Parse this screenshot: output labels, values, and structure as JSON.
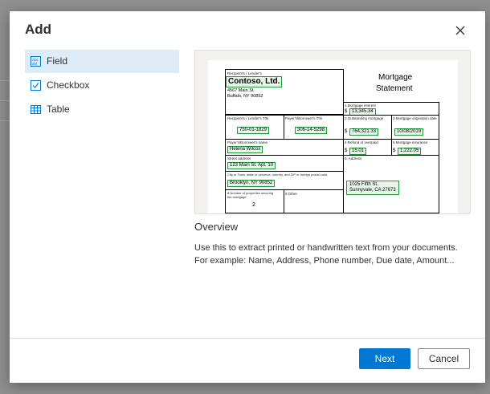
{
  "dialog": {
    "title": "Add",
    "close_icon": "close-icon"
  },
  "sidebar": {
    "items": [
      {
        "label": "Field",
        "icon": "field-icon",
        "active": true
      },
      {
        "label": "Checkbox",
        "icon": "checkbox-icon",
        "active": false
      },
      {
        "label": "Table",
        "icon": "table-icon",
        "active": false
      }
    ]
  },
  "preview": {
    "form_title_line1": "Mortgage",
    "form_title_line2": "Statement",
    "lender_label": "Recipient's / Lender's",
    "lender_name": "Contoso, Ltd.",
    "lender_address1": "4567 Main St.",
    "lender_address2": "Buffalo, NY 90852",
    "interest_label": "1.Mortgage interest",
    "interest_value": "13,345.34",
    "lender_tin_label": "Recipient's / Lender's TIN",
    "lender_tin_value": "750-01-1829",
    "payer_tin_label": "Payer's/Borrower's TIN",
    "payer_tin_value": "306-14-5298",
    "outstanding_label": "2.Outstanding mortgage",
    "outstanding_value": "764,321.33",
    "origination_label": "3.Mortgage origination date",
    "origination_value": "10/08/2019",
    "payer_name_label": "Payer's/Borrower's name",
    "payer_name_value": "Helena Wilcox",
    "refund_label": "4.Refund of overpaid",
    "refund_value": "15.01",
    "insurance_label": "5.Mortgage insurance",
    "insurance_value": "1,222.05",
    "street_label": "Street address",
    "street_value": "123 Main St. Apt. 10",
    "address_label": "6. Address",
    "property_value_line1": "1025 Fifth St.",
    "property_value_line2": "Sunnyvale, CA 27673",
    "city_label": "City or Town, state or province, country, and ZIP or foreign postal code",
    "city_value": "Brooklyn, NY 90852",
    "properties_label_line1": "8.Number of properties securing",
    "properties_label_line2": "the mortgage",
    "properties_value": "2",
    "other_label": "9.Other",
    "currency": "$"
  },
  "overview": {
    "title": "Overview",
    "description": "Use this to extract printed or handwritten text from your documents. For example: Name, Address, Phone number, Due date, Amount..."
  },
  "footer": {
    "next_label": "Next",
    "cancel_label": "Cancel"
  },
  "colors": {
    "accent": "#0078d4",
    "selected_bg": "#deecf9",
    "field_highlight": "#1f9a3a"
  }
}
